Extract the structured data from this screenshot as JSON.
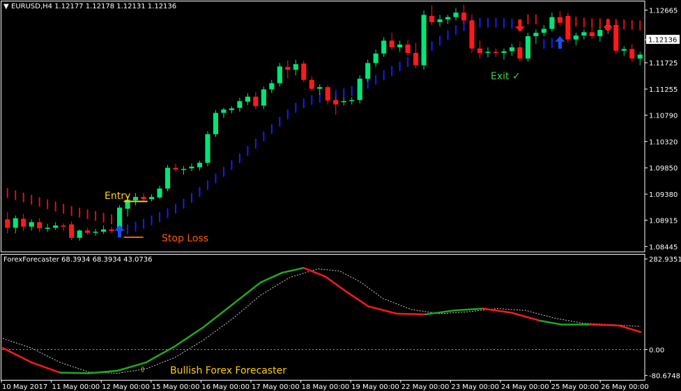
{
  "header": {
    "title": "EURUSD,H4  1.12177 1.12178 1.12131 1.12136"
  },
  "price_axis": {
    "labels": [
      "1.12665",
      "1.12136",
      "1.11725",
      "1.11255",
      "1.10790",
      "1.10320",
      "1.09850",
      "1.09380",
      "1.08915",
      "1.08445"
    ],
    "current_price": "1.12136"
  },
  "annotations": {
    "entry": "Entry",
    "stop_loss": "Stop Loss",
    "exit": "Exit ✓",
    "bullish": "Bullish Forex Forecaster"
  },
  "indicator": {
    "title": "ForexForecaster 68.3934 68.3934 43.0736",
    "axis_labels": [
      "282.9351",
      "0.00",
      "-80.6748"
    ]
  },
  "time_axis": {
    "labels": [
      "10 May 2017",
      "11 May 00:00",
      "12 May 00:00",
      "15 May 00:00",
      "16 May 00:00",
      "17 May 00:00",
      "18 May 00:00",
      "19 May 00:00",
      "22 May 00:00",
      "23 May 00:00",
      "24 May 00:00",
      "25 May 00:00",
      "26 May 00:00"
    ]
  },
  "colors": {
    "bull": "#00e676",
    "bear": "#ff1a1a",
    "trail_up": "#1a1aff",
    "trail_down": "#e01010",
    "entry_line": "#ffd000",
    "stop_line": "#ff5a00",
    "exit_text": "#3fcf3f",
    "osc_green": "#1faa1f",
    "osc_red": "#ff1a1a",
    "label_yellow": "#ffd000",
    "stop_text": "#ff5a00",
    "arrow_up": "#1a4dff",
    "arrow_down": "#ff1a1a"
  },
  "chart_data": {
    "type": "candlestick",
    "symbol": "EURUSD",
    "timeframe": "H4",
    "ylim": [
      1.0835,
      1.1282
    ],
    "osc_ylim": [
      -88,
      292
    ],
    "candles": [
      {
        "o": 1.0893,
        "h": 1.0906,
        "l": 1.0868,
        "c": 1.0878
      },
      {
        "o": 1.0878,
        "h": 1.09,
        "l": 1.0868,
        "c": 1.0895
      },
      {
        "o": 1.0894,
        "h": 1.0903,
        "l": 1.0872,
        "c": 1.088
      },
      {
        "o": 1.088,
        "h": 1.0893,
        "l": 1.0873,
        "c": 1.0888
      },
      {
        "o": 1.0888,
        "h": 1.0895,
        "l": 1.087,
        "c": 1.0877
      },
      {
        "o": 1.0876,
        "h": 1.0885,
        "l": 1.0871,
        "c": 1.0878
      },
      {
        "o": 1.0878,
        "h": 1.0888,
        "l": 1.0874,
        "c": 1.0882
      },
      {
        "o": 1.0882,
        "h": 1.0886,
        "l": 1.0872,
        "c": 1.088
      },
      {
        "o": 1.0884,
        "h": 1.0889,
        "l": 1.0856,
        "c": 1.086
      },
      {
        "o": 1.086,
        "h": 1.0875,
        "l": 1.0855,
        "c": 1.0873
      },
      {
        "o": 1.0873,
        "h": 1.0878,
        "l": 1.0866,
        "c": 1.0869
      },
      {
        "o": 1.0871,
        "h": 1.0876,
        "l": 1.0864,
        "c": 1.0871
      },
      {
        "o": 1.0871,
        "h": 1.0882,
        "l": 1.0867,
        "c": 1.0875
      },
      {
        "o": 1.0875,
        "h": 1.088,
        "l": 1.0868,
        "c": 1.0872
      },
      {
        "o": 1.0872,
        "h": 1.0918,
        "l": 1.0869,
        "c": 1.0914
      },
      {
        "o": 1.0912,
        "h": 1.0935,
        "l": 1.0898,
        "c": 1.0928
      },
      {
        "o": 1.0927,
        "h": 1.094,
        "l": 1.0918,
        "c": 1.0933
      },
      {
        "o": 1.0933,
        "h": 1.094,
        "l": 1.0926,
        "c": 1.0929
      },
      {
        "o": 1.0929,
        "h": 1.0938,
        "l": 1.0925,
        "c": 1.0933
      },
      {
        "o": 1.0932,
        "h": 1.0953,
        "l": 1.0929,
        "c": 1.0948
      },
      {
        "o": 1.0948,
        "h": 1.099,
        "l": 1.0943,
        "c": 1.0985
      },
      {
        "o": 1.0985,
        "h": 1.0992,
        "l": 1.0978,
        "c": 1.0982
      },
      {
        "o": 1.0982,
        "h": 1.0988,
        "l": 1.0973,
        "c": 1.0983
      },
      {
        "o": 1.0984,
        "h": 1.0993,
        "l": 1.0979,
        "c": 1.0987
      },
      {
        "o": 1.0986,
        "h": 1.0998,
        "l": 1.098,
        "c": 1.0994
      },
      {
        "o": 1.0994,
        "h": 1.105,
        "l": 1.0988,
        "c": 1.1045
      },
      {
        "o": 1.1045,
        "h": 1.1088,
        "l": 1.104,
        "c": 1.1083
      },
      {
        "o": 1.1083,
        "h": 1.1092,
        "l": 1.1074,
        "c": 1.1089
      },
      {
        "o": 1.1088,
        "h": 1.1095,
        "l": 1.1082,
        "c": 1.1091
      },
      {
        "o": 1.1092,
        "h": 1.111,
        "l": 1.1085,
        "c": 1.1104
      },
      {
        "o": 1.1103,
        "h": 1.1118,
        "l": 1.1097,
        "c": 1.1112
      },
      {
        "o": 1.1112,
        "h": 1.112,
        "l": 1.109,
        "c": 1.1095
      },
      {
        "o": 1.1096,
        "h": 1.113,
        "l": 1.109,
        "c": 1.1125
      },
      {
        "o": 1.1125,
        "h": 1.1142,
        "l": 1.1118,
        "c": 1.1136
      },
      {
        "o": 1.1136,
        "h": 1.1172,
        "l": 1.113,
        "c": 1.1166
      },
      {
        "o": 1.1165,
        "h": 1.1177,
        "l": 1.1145,
        "c": 1.116
      },
      {
        "o": 1.116,
        "h": 1.1178,
        "l": 1.115,
        "c": 1.117
      },
      {
        "o": 1.1171,
        "h": 1.1176,
        "l": 1.1138,
        "c": 1.1142
      },
      {
        "o": 1.1142,
        "h": 1.1148,
        "l": 1.1122,
        "c": 1.1126
      },
      {
        "o": 1.1126,
        "h": 1.1134,
        "l": 1.1115,
        "c": 1.1129
      },
      {
        "o": 1.1129,
        "h": 1.1132,
        "l": 1.1098,
        "c": 1.1105
      },
      {
        "o": 1.1106,
        "h": 1.1112,
        "l": 1.108,
        "c": 1.1098
      },
      {
        "o": 1.1102,
        "h": 1.111,
        "l": 1.1096,
        "c": 1.1104
      },
      {
        "o": 1.1104,
        "h": 1.1111,
        "l": 1.1098,
        "c": 1.1106
      },
      {
        "o": 1.1106,
        "h": 1.115,
        "l": 1.11,
        "c": 1.1144
      },
      {
        "o": 1.1144,
        "h": 1.1178,
        "l": 1.1138,
        "c": 1.1172
      },
      {
        "o": 1.1172,
        "h": 1.1196,
        "l": 1.1165,
        "c": 1.1189
      },
      {
        "o": 1.1189,
        "h": 1.1218,
        "l": 1.1183,
        "c": 1.1212
      },
      {
        "o": 1.1212,
        "h": 1.1226,
        "l": 1.1195,
        "c": 1.12
      },
      {
        "o": 1.12,
        "h": 1.1212,
        "l": 1.1192,
        "c": 1.1205
      },
      {
        "o": 1.1205,
        "h": 1.1213,
        "l": 1.1185,
        "c": 1.119
      },
      {
        "o": 1.119,
        "h": 1.1208,
        "l": 1.1163,
        "c": 1.1168
      },
      {
        "o": 1.1168,
        "h": 1.1266,
        "l": 1.116,
        "c": 1.1258
      },
      {
        "o": 1.1256,
        "h": 1.1275,
        "l": 1.124,
        "c": 1.1245
      },
      {
        "o": 1.1245,
        "h": 1.1258,
        "l": 1.1237,
        "c": 1.125
      },
      {
        "o": 1.125,
        "h": 1.1258,
        "l": 1.1242,
        "c": 1.1254
      },
      {
        "o": 1.1254,
        "h": 1.127,
        "l": 1.1248,
        "c": 1.1262
      },
      {
        "o": 1.1262,
        "h": 1.1276,
        "l": 1.1242,
        "c": 1.1248
      },
      {
        "o": 1.1248,
        "h": 1.1259,
        "l": 1.119,
        "c": 1.1198
      },
      {
        "o": 1.1198,
        "h": 1.1212,
        "l": 1.118,
        "c": 1.119
      },
      {
        "o": 1.119,
        "h": 1.12,
        "l": 1.1182,
        "c": 1.1192
      },
      {
        "o": 1.1192,
        "h": 1.1198,
        "l": 1.1183,
        "c": 1.119
      },
      {
        "o": 1.119,
        "h": 1.1198,
        "l": 1.1178,
        "c": 1.1193
      },
      {
        "o": 1.1193,
        "h": 1.1206,
        "l": 1.1185,
        "c": 1.12
      },
      {
        "o": 1.12,
        "h": 1.121,
        "l": 1.1175,
        "c": 1.118
      },
      {
        "o": 1.118,
        "h": 1.1226,
        "l": 1.1175,
        "c": 1.122
      },
      {
        "o": 1.122,
        "h": 1.1232,
        "l": 1.1206,
        "c": 1.1226
      },
      {
        "o": 1.1226,
        "h": 1.124,
        "l": 1.122,
        "c": 1.1233
      },
      {
        "o": 1.1233,
        "h": 1.1262,
        "l": 1.1228,
        "c": 1.1254
      },
      {
        "o": 1.1254,
        "h": 1.1265,
        "l": 1.1238,
        "c": 1.1244
      },
      {
        "o": 1.1256,
        "h": 1.1262,
        "l": 1.1208,
        "c": 1.1214
      },
      {
        "o": 1.1214,
        "h": 1.1226,
        "l": 1.1204,
        "c": 1.1221
      },
      {
        "o": 1.1221,
        "h": 1.1232,
        "l": 1.1214,
        "c": 1.1227
      },
      {
        "o": 1.1227,
        "h": 1.1234,
        "l": 1.1215,
        "c": 1.122
      },
      {
        "o": 1.122,
        "h": 1.1236,
        "l": 1.121,
        "c": 1.1231
      },
      {
        "o": 1.1231,
        "h": 1.1248,
        "l": 1.1224,
        "c": 1.124
      },
      {
        "o": 1.124,
        "h": 1.1248,
        "l": 1.1188,
        "c": 1.1194
      },
      {
        "o": 1.1194,
        "h": 1.1202,
        "l": 1.1185,
        "c": 1.1197
      },
      {
        "o": 1.1197,
        "h": 1.1206,
        "l": 1.1175,
        "c": 1.118
      },
      {
        "o": 1.118,
        "h": 1.1192,
        "l": 1.1168,
        "c": 1.1187
      }
    ],
    "trail_line": [
      {
        "i": 0,
        "v": 1.094,
        "dir": "down"
      },
      {
        "i": 1,
        "v": 1.0936,
        "dir": "down"
      },
      {
        "i": 2,
        "v": 1.0932,
        "dir": "down"
      },
      {
        "i": 3,
        "v": 1.0928,
        "dir": "down"
      },
      {
        "i": 4,
        "v": 1.0924,
        "dir": "down"
      },
      {
        "i": 5,
        "v": 1.092,
        "dir": "down"
      },
      {
        "i": 6,
        "v": 1.0916,
        "dir": "down"
      },
      {
        "i": 7,
        "v": 1.0912,
        "dir": "down"
      },
      {
        "i": 8,
        "v": 1.0908,
        "dir": "down"
      },
      {
        "i": 9,
        "v": 1.0905,
        "dir": "down"
      },
      {
        "i": 10,
        "v": 1.0902,
        "dir": "down"
      },
      {
        "i": 11,
        "v": 1.0899,
        "dir": "down"
      },
      {
        "i": 12,
        "v": 1.0896,
        "dir": "down"
      },
      {
        "i": 13,
        "v": 1.0893,
        "dir": "down"
      },
      {
        "i": 15,
        "v": 1.0875,
        "dir": "up"
      },
      {
        "i": 16,
        "v": 1.088,
        "dir": "up"
      },
      {
        "i": 17,
        "v": 1.0885,
        "dir": "up"
      },
      {
        "i": 18,
        "v": 1.0891,
        "dir": "up"
      },
      {
        "i": 19,
        "v": 1.0897,
        "dir": "up"
      },
      {
        "i": 20,
        "v": 1.0904,
        "dir": "up"
      },
      {
        "i": 21,
        "v": 1.0912,
        "dir": "up"
      },
      {
        "i": 22,
        "v": 1.0921,
        "dir": "up"
      },
      {
        "i": 23,
        "v": 1.0931,
        "dir": "up"
      },
      {
        "i": 24,
        "v": 1.0942,
        "dir": "up"
      },
      {
        "i": 25,
        "v": 1.0954,
        "dir": "up"
      },
      {
        "i": 26,
        "v": 1.0966,
        "dir": "up"
      },
      {
        "i": 27,
        "v": 1.0978,
        "dir": "up"
      },
      {
        "i": 28,
        "v": 1.099,
        "dir": "up"
      },
      {
        "i": 29,
        "v": 1.1002,
        "dir": "up"
      },
      {
        "i": 30,
        "v": 1.1015,
        "dir": "up"
      },
      {
        "i": 31,
        "v": 1.1028,
        "dir": "up"
      },
      {
        "i": 32,
        "v": 1.1041,
        "dir": "up"
      },
      {
        "i": 33,
        "v": 1.1054,
        "dir": "up"
      },
      {
        "i": 34,
        "v": 1.1067,
        "dir": "up"
      },
      {
        "i": 35,
        "v": 1.108,
        "dir": "up"
      },
      {
        "i": 36,
        "v": 1.1092,
        "dir": "up"
      },
      {
        "i": 37,
        "v": 1.11,
        "dir": "up"
      },
      {
        "i": 38,
        "v": 1.1106,
        "dir": "up"
      },
      {
        "i": 39,
        "v": 1.111,
        "dir": "up"
      },
      {
        "i": 40,
        "v": 1.1113,
        "dir": "up"
      },
      {
        "i": 41,
        "v": 1.1115,
        "dir": "up"
      },
      {
        "i": 42,
        "v": 1.1118,
        "dir": "up"
      },
      {
        "i": 43,
        "v": 1.1122,
        "dir": "up"
      },
      {
        "i": 44,
        "v": 1.1128,
        "dir": "up"
      },
      {
        "i": 45,
        "v": 1.1135,
        "dir": "up"
      },
      {
        "i": 46,
        "v": 1.1142,
        "dir": "up"
      },
      {
        "i": 47,
        "v": 1.115,
        "dir": "up"
      },
      {
        "i": 48,
        "v": 1.1158,
        "dir": "up"
      },
      {
        "i": 49,
        "v": 1.1166,
        "dir": "up"
      },
      {
        "i": 50,
        "v": 1.1174,
        "dir": "up"
      },
      {
        "i": 51,
        "v": 1.1182,
        "dir": "up"
      },
      {
        "i": 52,
        "v": 1.1192,
        "dir": "up"
      },
      {
        "i": 53,
        "v": 1.1202,
        "dir": "up"
      },
      {
        "i": 54,
        "v": 1.1212,
        "dir": "up"
      },
      {
        "i": 55,
        "v": 1.1222,
        "dir": "up"
      },
      {
        "i": 56,
        "v": 1.1231,
        "dir": "up"
      },
      {
        "i": 57,
        "v": 1.1238,
        "dir": "up"
      },
      {
        "i": 58,
        "v": 1.1242,
        "dir": "up"
      },
      {
        "i": 59,
        "v": 1.1244,
        "dir": "up"
      },
      {
        "i": 60,
        "v": 1.1244,
        "dir": "up"
      },
      {
        "i": 61,
        "v": 1.1244,
        "dir": "up"
      },
      {
        "i": 62,
        "v": 1.1243,
        "dir": "up"
      },
      {
        "i": 63,
        "v": 1.1242,
        "dir": "up"
      },
      {
        "i": 64,
        "v": 1.1241,
        "dir": "up"
      },
      {
        "i": 65,
        "v": 1.125,
        "dir": "down"
      },
      {
        "i": 66,
        "v": 1.125,
        "dir": "down"
      },
      {
        "i": 67,
        "v": 1.1206,
        "dir": "up"
      },
      {
        "i": 68,
        "v": 1.1208,
        "dir": "up"
      },
      {
        "i": 69,
        "v": 1.121,
        "dir": "up"
      },
      {
        "i": 70,
        "v": 1.1248,
        "dir": "down"
      },
      {
        "i": 71,
        "v": 1.1246,
        "dir": "down"
      },
      {
        "i": 72,
        "v": 1.1244,
        "dir": "down"
      },
      {
        "i": 73,
        "v": 1.1243,
        "dir": "down"
      },
      {
        "i": 74,
        "v": 1.1243,
        "dir": "down"
      },
      {
        "i": 75,
        "v": 1.1243,
        "dir": "down"
      },
      {
        "i": 76,
        "v": 1.1242,
        "dir": "down"
      },
      {
        "i": 77,
        "v": 1.1241,
        "dir": "down"
      },
      {
        "i": 78,
        "v": 1.124,
        "dir": "down"
      },
      {
        "i": 79,
        "v": 1.1239,
        "dir": "down"
      }
    ],
    "signals": [
      {
        "i": 14,
        "type": "buy",
        "price": 1.0868
      },
      {
        "i": 64,
        "type": "sell",
        "price": 1.124
      },
      {
        "i": 69,
        "type": "buy",
        "price": 1.1205
      },
      {
        "i": 75,
        "type": "sell",
        "price": 1.124
      }
    ],
    "entry_price": 1.0925,
    "stop_loss_price": 1.0861,
    "oscillator": {
      "main": [
        {
          "i": 0,
          "v": 5,
          "c": "red"
        },
        {
          "i": 4,
          "v": -40,
          "c": "red"
        },
        {
          "i": 8,
          "v": -72,
          "c": "red"
        },
        {
          "i": 12,
          "v": -74,
          "c": "green"
        },
        {
          "i": 16,
          "v": -66,
          "c": "green"
        },
        {
          "i": 20,
          "v": -40,
          "c": "green"
        },
        {
          "i": 24,
          "v": 10,
          "c": "green"
        },
        {
          "i": 28,
          "v": 70,
          "c": "green"
        },
        {
          "i": 32,
          "v": 140,
          "c": "green"
        },
        {
          "i": 36,
          "v": 210,
          "c": "green"
        },
        {
          "i": 39,
          "v": 240,
          "c": "green"
        },
        {
          "i": 42,
          "v": 255,
          "c": "green"
        },
        {
          "i": 45,
          "v": 228,
          "c": "red"
        },
        {
          "i": 48,
          "v": 180,
          "c": "red"
        },
        {
          "i": 51,
          "v": 135,
          "c": "red"
        },
        {
          "i": 55,
          "v": 112,
          "c": "red"
        },
        {
          "i": 59,
          "v": 110,
          "c": "red"
        },
        {
          "i": 63,
          "v": 122,
          "c": "green"
        },
        {
          "i": 67,
          "v": 128,
          "c": "green"
        },
        {
          "i": 71,
          "v": 115,
          "c": "red"
        },
        {
          "i": 75,
          "v": 90,
          "c": "red"
        },
        {
          "i": 78,
          "v": 78,
          "c": "green"
        },
        {
          "i": 82,
          "v": 78,
          "c": "green"
        },
        {
          "i": 86,
          "v": 75,
          "c": "red"
        },
        {
          "i": 89,
          "v": 55,
          "c": "red"
        }
      ],
      "signal": [
        {
          "i": 0,
          "v": 35
        },
        {
          "i": 4,
          "v": 5
        },
        {
          "i": 8,
          "v": -40
        },
        {
          "i": 12,
          "v": -70
        },
        {
          "i": 16,
          "v": -74
        },
        {
          "i": 20,
          "v": -60
        },
        {
          "i": 24,
          "v": -25
        },
        {
          "i": 28,
          "v": 30
        },
        {
          "i": 32,
          "v": 95
        },
        {
          "i": 36,
          "v": 170
        },
        {
          "i": 40,
          "v": 225
        },
        {
          "i": 44,
          "v": 252
        },
        {
          "i": 47,
          "v": 245
        },
        {
          "i": 50,
          "v": 210
        },
        {
          "i": 53,
          "v": 160
        },
        {
          "i": 57,
          "v": 125
        },
        {
          "i": 61,
          "v": 112
        },
        {
          "i": 65,
          "v": 118
        },
        {
          "i": 69,
          "v": 128
        },
        {
          "i": 73,
          "v": 122
        },
        {
          "i": 77,
          "v": 98
        },
        {
          "i": 81,
          "v": 82
        },
        {
          "i": 85,
          "v": 78
        },
        {
          "i": 89,
          "v": 72
        }
      ],
      "zero_level": 0
    }
  }
}
